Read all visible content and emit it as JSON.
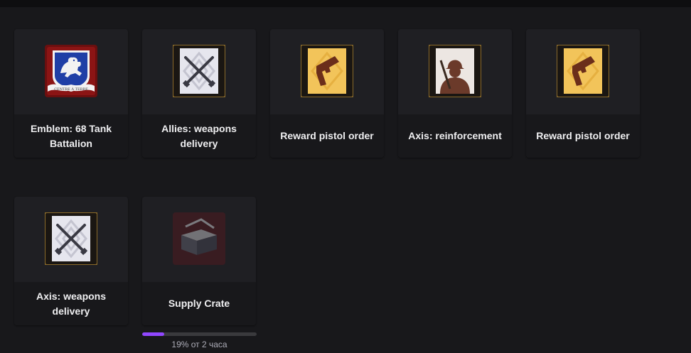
{
  "drops": [
    {
      "name": "Emblem: 68 Tank Battalion",
      "icon": "tank-battalion-emblem-icon"
    },
    {
      "name": "Allies: weapons delivery",
      "icon": "crossed-rifles-card-icon"
    },
    {
      "name": "Reward pistol order",
      "icon": "pistol-card-icon"
    },
    {
      "name": "Axis: reinforcement",
      "icon": "soldier-card-icon"
    },
    {
      "name": "Reward pistol order",
      "icon": "pistol-card-icon"
    },
    {
      "name": "Axis: weapons delivery",
      "icon": "crossed-rifles-card-icon"
    },
    {
      "name": "Supply Crate",
      "icon": "supply-crate-icon"
    }
  ],
  "progress": {
    "value": 0.19,
    "text": "19% от 2 часа"
  },
  "colors": {
    "background": "#18181b",
    "card": "#1f1f23",
    "accent": "#9147ff",
    "text": "#efeff1"
  }
}
